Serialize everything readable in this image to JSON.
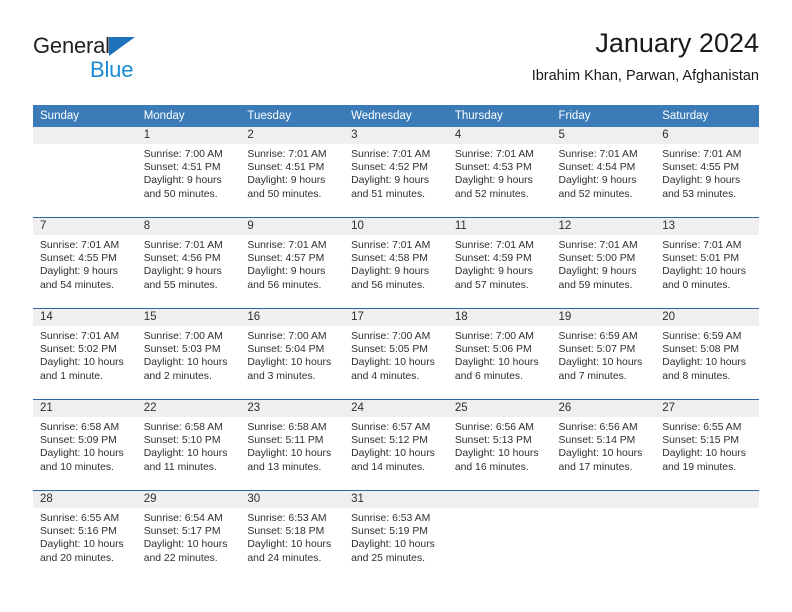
{
  "brand": {
    "name_top": "General",
    "name_bottom": "Blue",
    "triangle_color": "#1d72bb",
    "blue_text_color": "#1c8ad4"
  },
  "header": {
    "title": "January 2024",
    "subtitle": "Ibrahim Khan, Parwan, Afghanistan"
  },
  "theme": {
    "header_bg": "#3b7cb8",
    "row_divider": "#2d68a5",
    "daynum_bg": "#efefef",
    "text": "#2f2f2f"
  },
  "weekday_headers": [
    "Sunday",
    "Monday",
    "Tuesday",
    "Wednesday",
    "Thursday",
    "Friday",
    "Saturday"
  ],
  "weeks": [
    [
      {
        "day": "",
        "sunrise": "",
        "sunset": "",
        "daylight_1": "",
        "daylight_2": "",
        "empty": true
      },
      {
        "day": "1",
        "sunrise": "Sunrise: 7:00 AM",
        "sunset": "Sunset: 4:51 PM",
        "daylight_1": "Daylight: 9 hours",
        "daylight_2": "and 50 minutes."
      },
      {
        "day": "2",
        "sunrise": "Sunrise: 7:01 AM",
        "sunset": "Sunset: 4:51 PM",
        "daylight_1": "Daylight: 9 hours",
        "daylight_2": "and 50 minutes."
      },
      {
        "day": "3",
        "sunrise": "Sunrise: 7:01 AM",
        "sunset": "Sunset: 4:52 PM",
        "daylight_1": "Daylight: 9 hours",
        "daylight_2": "and 51 minutes."
      },
      {
        "day": "4",
        "sunrise": "Sunrise: 7:01 AM",
        "sunset": "Sunset: 4:53 PM",
        "daylight_1": "Daylight: 9 hours",
        "daylight_2": "and 52 minutes."
      },
      {
        "day": "5",
        "sunrise": "Sunrise: 7:01 AM",
        "sunset": "Sunset: 4:54 PM",
        "daylight_1": "Daylight: 9 hours",
        "daylight_2": "and 52 minutes."
      },
      {
        "day": "6",
        "sunrise": "Sunrise: 7:01 AM",
        "sunset": "Sunset: 4:55 PM",
        "daylight_1": "Daylight: 9 hours",
        "daylight_2": "and 53 minutes."
      }
    ],
    [
      {
        "day": "7",
        "sunrise": "Sunrise: 7:01 AM",
        "sunset": "Sunset: 4:55 PM",
        "daylight_1": "Daylight: 9 hours",
        "daylight_2": "and 54 minutes."
      },
      {
        "day": "8",
        "sunrise": "Sunrise: 7:01 AM",
        "sunset": "Sunset: 4:56 PM",
        "daylight_1": "Daylight: 9 hours",
        "daylight_2": "and 55 minutes."
      },
      {
        "day": "9",
        "sunrise": "Sunrise: 7:01 AM",
        "sunset": "Sunset: 4:57 PM",
        "daylight_1": "Daylight: 9 hours",
        "daylight_2": "and 56 minutes."
      },
      {
        "day": "10",
        "sunrise": "Sunrise: 7:01 AM",
        "sunset": "Sunset: 4:58 PM",
        "daylight_1": "Daylight: 9 hours",
        "daylight_2": "and 56 minutes."
      },
      {
        "day": "11",
        "sunrise": "Sunrise: 7:01 AM",
        "sunset": "Sunset: 4:59 PM",
        "daylight_1": "Daylight: 9 hours",
        "daylight_2": "and 57 minutes."
      },
      {
        "day": "12",
        "sunrise": "Sunrise: 7:01 AM",
        "sunset": "Sunset: 5:00 PM",
        "daylight_1": "Daylight: 9 hours",
        "daylight_2": "and 59 minutes."
      },
      {
        "day": "13",
        "sunrise": "Sunrise: 7:01 AM",
        "sunset": "Sunset: 5:01 PM",
        "daylight_1": "Daylight: 10 hours",
        "daylight_2": "and 0 minutes."
      }
    ],
    [
      {
        "day": "14",
        "sunrise": "Sunrise: 7:01 AM",
        "sunset": "Sunset: 5:02 PM",
        "daylight_1": "Daylight: 10 hours",
        "daylight_2": "and 1 minute."
      },
      {
        "day": "15",
        "sunrise": "Sunrise: 7:00 AM",
        "sunset": "Sunset: 5:03 PM",
        "daylight_1": "Daylight: 10 hours",
        "daylight_2": "and 2 minutes."
      },
      {
        "day": "16",
        "sunrise": "Sunrise: 7:00 AM",
        "sunset": "Sunset: 5:04 PM",
        "daylight_1": "Daylight: 10 hours",
        "daylight_2": "and 3 minutes."
      },
      {
        "day": "17",
        "sunrise": "Sunrise: 7:00 AM",
        "sunset": "Sunset: 5:05 PM",
        "daylight_1": "Daylight: 10 hours",
        "daylight_2": "and 4 minutes."
      },
      {
        "day": "18",
        "sunrise": "Sunrise: 7:00 AM",
        "sunset": "Sunset: 5:06 PM",
        "daylight_1": "Daylight: 10 hours",
        "daylight_2": "and 6 minutes."
      },
      {
        "day": "19",
        "sunrise": "Sunrise: 6:59 AM",
        "sunset": "Sunset: 5:07 PM",
        "daylight_1": "Daylight: 10 hours",
        "daylight_2": "and 7 minutes."
      },
      {
        "day": "20",
        "sunrise": "Sunrise: 6:59 AM",
        "sunset": "Sunset: 5:08 PM",
        "daylight_1": "Daylight: 10 hours",
        "daylight_2": "and 8 minutes."
      }
    ],
    [
      {
        "day": "21",
        "sunrise": "Sunrise: 6:58 AM",
        "sunset": "Sunset: 5:09 PM",
        "daylight_1": "Daylight: 10 hours",
        "daylight_2": "and 10 minutes."
      },
      {
        "day": "22",
        "sunrise": "Sunrise: 6:58 AM",
        "sunset": "Sunset: 5:10 PM",
        "daylight_1": "Daylight: 10 hours",
        "daylight_2": "and 11 minutes."
      },
      {
        "day": "23",
        "sunrise": "Sunrise: 6:58 AM",
        "sunset": "Sunset: 5:11 PM",
        "daylight_1": "Daylight: 10 hours",
        "daylight_2": "and 13 minutes."
      },
      {
        "day": "24",
        "sunrise": "Sunrise: 6:57 AM",
        "sunset": "Sunset: 5:12 PM",
        "daylight_1": "Daylight: 10 hours",
        "daylight_2": "and 14 minutes."
      },
      {
        "day": "25",
        "sunrise": "Sunrise: 6:56 AM",
        "sunset": "Sunset: 5:13 PM",
        "daylight_1": "Daylight: 10 hours",
        "daylight_2": "and 16 minutes."
      },
      {
        "day": "26",
        "sunrise": "Sunrise: 6:56 AM",
        "sunset": "Sunset: 5:14 PM",
        "daylight_1": "Daylight: 10 hours",
        "daylight_2": "and 17 minutes."
      },
      {
        "day": "27",
        "sunrise": "Sunrise: 6:55 AM",
        "sunset": "Sunset: 5:15 PM",
        "daylight_1": "Daylight: 10 hours",
        "daylight_2": "and 19 minutes."
      }
    ],
    [
      {
        "day": "28",
        "sunrise": "Sunrise: 6:55 AM",
        "sunset": "Sunset: 5:16 PM",
        "daylight_1": "Daylight: 10 hours",
        "daylight_2": "and 20 minutes."
      },
      {
        "day": "29",
        "sunrise": "Sunrise: 6:54 AM",
        "sunset": "Sunset: 5:17 PM",
        "daylight_1": "Daylight: 10 hours",
        "daylight_2": "and 22 minutes."
      },
      {
        "day": "30",
        "sunrise": "Sunrise: 6:53 AM",
        "sunset": "Sunset: 5:18 PM",
        "daylight_1": "Daylight: 10 hours",
        "daylight_2": "and 24 minutes."
      },
      {
        "day": "31",
        "sunrise": "Sunrise: 6:53 AM",
        "sunset": "Sunset: 5:19 PM",
        "daylight_1": "Daylight: 10 hours",
        "daylight_2": "and 25 minutes."
      },
      {
        "day": "",
        "sunrise": "",
        "sunset": "",
        "daylight_1": "",
        "daylight_2": "",
        "empty": true
      },
      {
        "day": "",
        "sunrise": "",
        "sunset": "",
        "daylight_1": "",
        "daylight_2": "",
        "empty": true
      },
      {
        "day": "",
        "sunrise": "",
        "sunset": "",
        "daylight_1": "",
        "daylight_2": "",
        "empty": true
      }
    ]
  ]
}
